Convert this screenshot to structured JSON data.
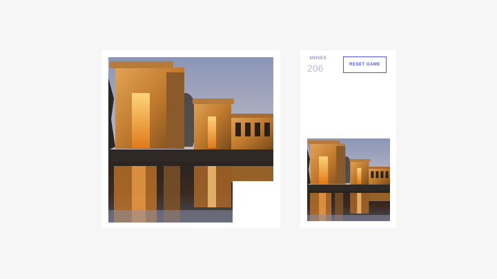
{
  "game": {
    "moves_label": "MOVES",
    "moves_value": "206",
    "reset_label": "RESET GAME"
  },
  "colors": {
    "accent": "#4b54d6",
    "background": "#f6f6f6",
    "card": "#ffffff"
  },
  "puzzle": {
    "grid_size": 4,
    "image_subject": "temple-at-dusk-photo"
  }
}
